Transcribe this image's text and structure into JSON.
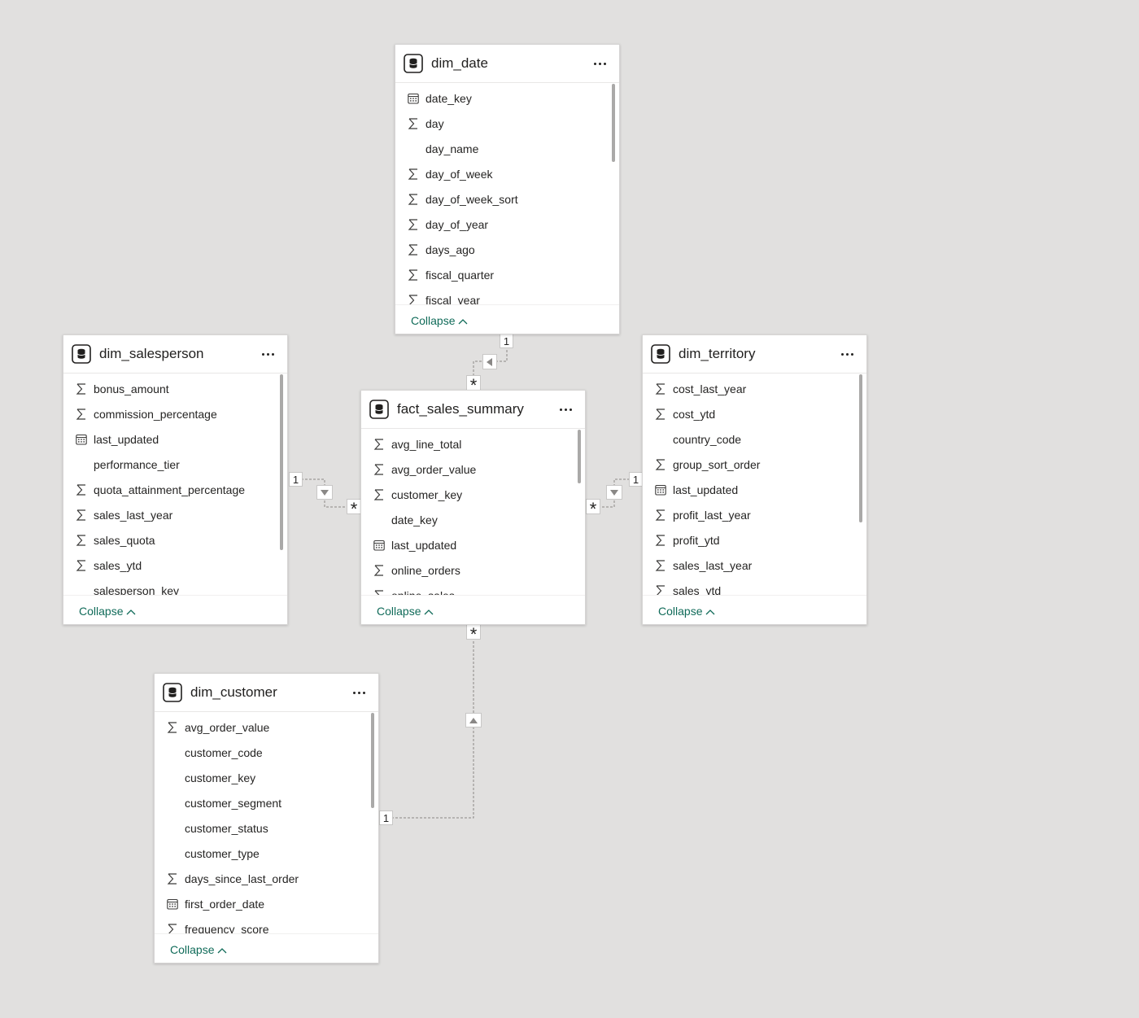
{
  "tables": {
    "dim_date": {
      "name": "dim_date",
      "collapse_label": "Collapse",
      "fields": [
        {
          "label": "date_key",
          "icon": "calendar-icon"
        },
        {
          "label": "day",
          "icon": "sigma-icon"
        },
        {
          "label": "day_name",
          "icon": "none"
        },
        {
          "label": "day_of_week",
          "icon": "sigma-icon"
        },
        {
          "label": "day_of_week_sort",
          "icon": "sigma-icon"
        },
        {
          "label": "day_of_year",
          "icon": "sigma-icon"
        },
        {
          "label": "days_ago",
          "icon": "sigma-icon"
        },
        {
          "label": "fiscal_quarter",
          "icon": "sigma-icon"
        },
        {
          "label": "fiscal_year",
          "icon": "sigma-icon"
        }
      ]
    },
    "dim_salesperson": {
      "name": "dim_salesperson",
      "collapse_label": "Collapse",
      "fields": [
        {
          "label": "bonus_amount",
          "icon": "sigma-icon"
        },
        {
          "label": "commission_percentage",
          "icon": "sigma-icon"
        },
        {
          "label": "last_updated",
          "icon": "calendar-icon"
        },
        {
          "label": "performance_tier",
          "icon": "none"
        },
        {
          "label": "quota_attainment_percentage",
          "icon": "sigma-icon"
        },
        {
          "label": "sales_last_year",
          "icon": "sigma-icon"
        },
        {
          "label": "sales_quota",
          "icon": "sigma-icon"
        },
        {
          "label": "sales_ytd",
          "icon": "sigma-icon"
        },
        {
          "label": "salesperson_key",
          "icon": "none"
        }
      ]
    },
    "fact_sales_summary": {
      "name": "fact_sales_summary",
      "collapse_label": "Collapse",
      "fields": [
        {
          "label": "avg_line_total",
          "icon": "sigma-icon"
        },
        {
          "label": "avg_order_value",
          "icon": "sigma-icon"
        },
        {
          "label": "customer_key",
          "icon": "sigma-icon"
        },
        {
          "label": "date_key",
          "icon": "none"
        },
        {
          "label": "last_updated",
          "icon": "calendar-icon"
        },
        {
          "label": "online_orders",
          "icon": "sigma-icon"
        },
        {
          "label": "online_sales",
          "icon": "sigma-icon"
        }
      ]
    },
    "dim_territory": {
      "name": "dim_territory",
      "collapse_label": "Collapse",
      "fields": [
        {
          "label": "cost_last_year",
          "icon": "sigma-icon"
        },
        {
          "label": "cost_ytd",
          "icon": "sigma-icon"
        },
        {
          "label": "country_code",
          "icon": "none"
        },
        {
          "label": "group_sort_order",
          "icon": "sigma-icon"
        },
        {
          "label": "last_updated",
          "icon": "calendar-icon"
        },
        {
          "label": "profit_last_year",
          "icon": "sigma-icon"
        },
        {
          "label": "profit_ytd",
          "icon": "sigma-icon"
        },
        {
          "label": "sales_last_year",
          "icon": "sigma-icon"
        },
        {
          "label": "sales_ytd",
          "icon": "sigma-icon"
        }
      ]
    },
    "dim_customer": {
      "name": "dim_customer",
      "collapse_label": "Collapse",
      "fields": [
        {
          "label": "avg_order_value",
          "icon": "sigma-icon"
        },
        {
          "label": "customer_code",
          "icon": "none"
        },
        {
          "label": "customer_key",
          "icon": "none"
        },
        {
          "label": "customer_segment",
          "icon": "none"
        },
        {
          "label": "customer_status",
          "icon": "none"
        },
        {
          "label": "customer_type",
          "icon": "none"
        },
        {
          "label": "days_since_last_order",
          "icon": "sigma-icon"
        },
        {
          "label": "first_order_date",
          "icon": "calendar-icon"
        },
        {
          "label": "frequency_score",
          "icon": "sigma-icon"
        }
      ]
    }
  },
  "relationships": {
    "date_to_fact": {
      "one": "1",
      "many": "*"
    },
    "salesperson_to_fact": {
      "one": "1",
      "many": "*"
    },
    "territory_to_fact": {
      "one": "1",
      "many": "*"
    },
    "customer_to_fact": {
      "one": "1",
      "many": "*"
    }
  },
  "colors": {
    "canvas": "#e1e0df",
    "accent": "#106b59",
    "text": "#252423"
  }
}
